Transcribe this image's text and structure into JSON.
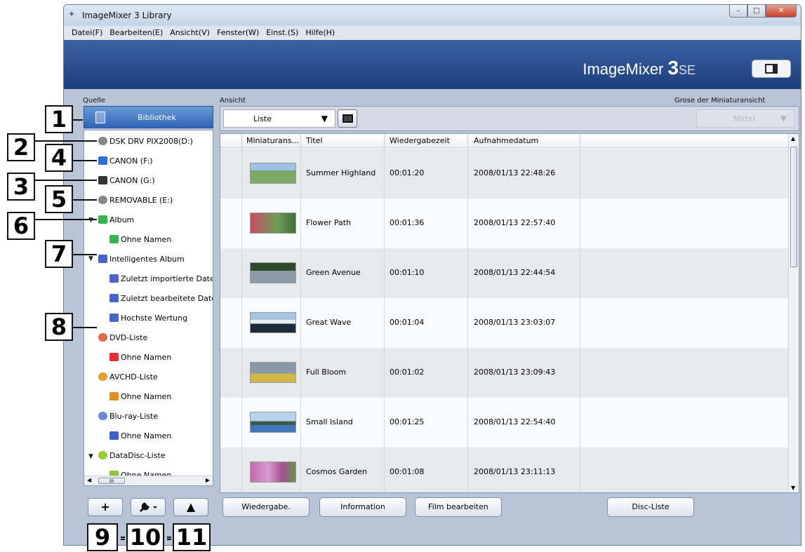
{
  "window": {
    "title": "ImageMixer 3 Library"
  },
  "menu": [
    "Datei(F)",
    "Bearbeiten(E)",
    "Ansicht(V)",
    "Fenster(W)",
    "Einst.(S)",
    "Hilfe(H)"
  ],
  "brand": {
    "main": "ImageMixer",
    "number": "3",
    "suffix": "SE"
  },
  "labels": {
    "source": "Quelle",
    "view": "Ansicht",
    "thumb_size": "Grose der Miniaturansicht"
  },
  "library_button": "Bibliothek",
  "tree": [
    {
      "label": "DSK DRV PIX2008(D:)",
      "icon": "drive-icon"
    },
    {
      "label": "CANON (F:)",
      "icon": "sd-card-icon"
    },
    {
      "label": "CANON (G:)",
      "icon": "memory-card-icon"
    },
    {
      "label": "REMOVABLE (E:)",
      "icon": "drive-icon"
    },
    {
      "label": "Album",
      "icon": "album-icon"
    },
    {
      "label": "Ohne Namen",
      "icon": "album-icon"
    },
    {
      "label": "Intelligentes Album",
      "icon": "smart-album-icon"
    },
    {
      "label": "Zuletzt importierte Datei",
      "icon": "smart-album-icon"
    },
    {
      "label": "Zuletzt bearbeitete Datei",
      "icon": "smart-album-icon"
    },
    {
      "label": "Hochste Wertung",
      "icon": "smart-album-icon"
    },
    {
      "label": "DVD-Liste",
      "icon": "disc-icon"
    },
    {
      "label": "Ohne Namen",
      "icon": "disc-red-icon"
    },
    {
      "label": "AVCHD-Liste",
      "icon": "disc-icon"
    },
    {
      "label": "Ohne Namen",
      "icon": "disc-orange-icon"
    },
    {
      "label": "Blu-ray-Liste",
      "icon": "disc-icon"
    },
    {
      "label": "Ohne Namen",
      "icon": "disc-blue-icon"
    },
    {
      "label": "DataDisc-Liste",
      "icon": "disc-icon"
    },
    {
      "label": "Ohne Namen",
      "icon": "disc-green-icon"
    }
  ],
  "scroll_thumb_label": "III",
  "tool_buttons": [
    "+",
    "",
    "▲"
  ],
  "view_select": "Liste",
  "size_select": "Mittel",
  "columns": [
    "Miniaturans...",
    "Titel",
    "Wiedergabezeit",
    "Aufnahmedatum"
  ],
  "rows": [
    {
      "title": "Summer Highland",
      "duration": "00:01:20",
      "date": "2008/01/13 22:48:26"
    },
    {
      "title": "Flower Path",
      "duration": "00:01:36",
      "date": "2008/01/13 22:57:40"
    },
    {
      "title": "Green Avenue",
      "duration": "00:01:10",
      "date": "2008/01/13 22:44:54"
    },
    {
      "title": "Great Wave",
      "duration": "00:01:04",
      "date": "2008/01/13 23:03:07"
    },
    {
      "title": "Full Bloom",
      "duration": "00:01:02",
      "date": "2008/01/13 23:09:43"
    },
    {
      "title": "Small Island",
      "duration": "00:01:25",
      "date": "2008/01/13 22:54:40"
    },
    {
      "title": "Cosmos Garden",
      "duration": "00:01:08",
      "date": "2008/01/13 23:11:13"
    }
  ],
  "action_buttons": [
    "Wiedergabe.",
    "Information",
    "Film bearbeiten",
    "Disc-Liste"
  ],
  "callouts": [
    "1",
    "2",
    "3",
    "4",
    "5",
    "6",
    "7",
    "8",
    "9",
    "10",
    "11"
  ],
  "colors": {
    "brand_bar": "#2a4d8f",
    "library_selected": "#3c70c0"
  }
}
